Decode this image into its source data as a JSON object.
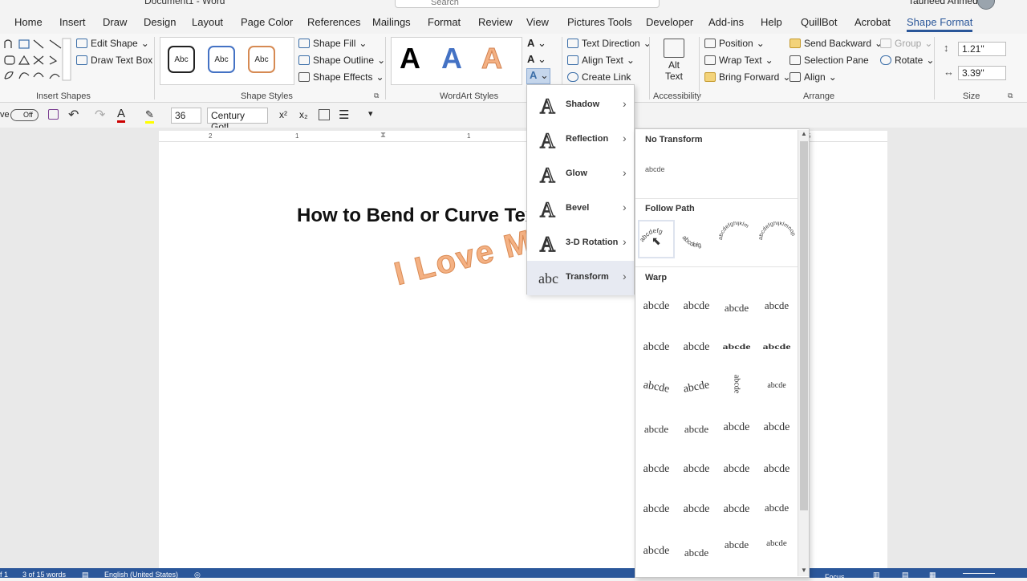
{
  "titlebar": {
    "document": "Document1 - Word",
    "search_placeholder": "Search",
    "user": "Tauheed Ahmed"
  },
  "tabs": [
    {
      "label": "Home"
    },
    {
      "label": "Insert"
    },
    {
      "label": "Draw"
    },
    {
      "label": "Design"
    },
    {
      "label": "Layout"
    },
    {
      "label": "Page Color"
    },
    {
      "label": "References"
    },
    {
      "label": "Mailings"
    },
    {
      "label": "Format"
    },
    {
      "label": "Review"
    },
    {
      "label": "View"
    },
    {
      "label": "Pictures Tools"
    },
    {
      "label": "Developer"
    },
    {
      "label": "Add-ins"
    },
    {
      "label": "Help"
    },
    {
      "label": "QuillBot"
    },
    {
      "label": "Acrobat"
    },
    {
      "label": "Shape Format"
    }
  ],
  "ribbon": {
    "insert_shapes": {
      "edit_shape": "Edit Shape",
      "draw_text_box": "Draw Text Box",
      "label": "Insert Shapes"
    },
    "shape_styles": {
      "sample": "Abc",
      "shape_fill": "Shape Fill",
      "shape_outline": "Shape Outline",
      "shape_effects": "Shape Effects",
      "label": "Shape Styles"
    },
    "wordart_styles": {
      "sample": "A",
      "label": "WordArt Styles"
    },
    "text": {
      "text_direction": "Text Direction",
      "align_text": "Align Text",
      "create_link": "Create Link"
    },
    "accessibility": {
      "alt_text_1": "Alt",
      "alt_text_2": "Text",
      "label": "Accessibility"
    },
    "arrange": {
      "position": "Position",
      "wrap_text": "Wrap Text",
      "bring_forward": "Bring Forward",
      "send_backward": "Send Backward",
      "selection_pane": "Selection Pane",
      "align": "Align",
      "group": "Group",
      "rotate": "Rotate",
      "label": "Arrange"
    },
    "size": {
      "height": "1.21\"",
      "width": "3.39\"",
      "label": "Size"
    }
  },
  "qat": {
    "autosave": "Off",
    "autosave_prefix": "ve",
    "font_size": "36",
    "font_name": "Century Gotl"
  },
  "ruler": {
    "left": "2",
    "mid": "1",
    "right": "1",
    "far": "5"
  },
  "document": {
    "heading": "How to Bend or Curve Tex",
    "wordart": "I Love M"
  },
  "text_effects_menu": {
    "items": [
      {
        "label": "Shadow"
      },
      {
        "label": "Reflection"
      },
      {
        "label": "Glow"
      },
      {
        "label": "Bevel"
      },
      {
        "label": "3-D Rotation"
      },
      {
        "label": "Transform"
      }
    ],
    "glyph": "A",
    "transform_glyph": "abc"
  },
  "transform_submenu": {
    "no_transform_title": "No Transform",
    "no_transform_sample": "abcde",
    "follow_path_title": "Follow Path",
    "follow_path_samples": [
      "abcdefg",
      "abcdefg",
      "abcdefghijklm",
      "abcdefghijklmnop"
    ],
    "warp_title": "Warp",
    "warp_sample": "abcde"
  },
  "status": {
    "page": "f 1",
    "words": "3 of 15 words",
    "language": "English (United States)",
    "focus": "Focus"
  }
}
